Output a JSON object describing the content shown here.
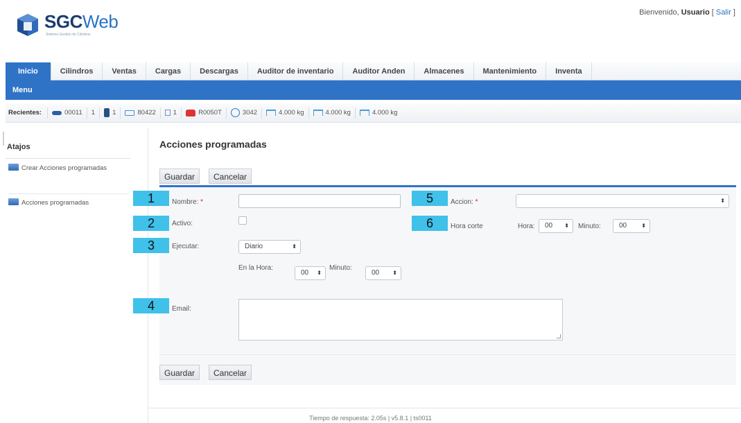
{
  "header": {
    "logo_bold": "SGC",
    "logo_light": "Web",
    "logo_subtitle": "Sistema Gestión de Cilindros",
    "welcome_prefix": "Bienvenido, ",
    "user_name": "Usuario",
    "logout_open": " [ ",
    "logout_label": "Salir",
    "logout_close": " ]"
  },
  "nav": {
    "tabs": [
      "Inicio",
      "Cilindros",
      "Ventas",
      "Cargas",
      "Descargas",
      "Auditor de inventario",
      "Auditor Anden",
      "Almacenes",
      "Mantenimiento",
      "Inventa"
    ],
    "menu_label": "Menu"
  },
  "recents": {
    "label": "Recientes:",
    "items": [
      "00011",
      "1",
      "1",
      "80422",
      "1",
      "R0050T",
      "3042",
      "4.000 kg",
      "4.000 kg",
      "4.000 kg"
    ]
  },
  "sidebar": {
    "heading": "Atajos",
    "items": [
      "Crear Acciones programadas",
      "Acciones programadas"
    ]
  },
  "page": {
    "title": "Acciones programadas",
    "save_label": "Guardar",
    "cancel_label": "Cancelar"
  },
  "form": {
    "nombre_label": "Nombre:",
    "required_mark": " *",
    "activo_label": "Activo:",
    "ejecutar_label": "Ejecutar:",
    "ejecutar_value": "Diario",
    "en_la_hora_label": "En la Hora:",
    "hora_value": "00",
    "minuto_label": "Minuto:",
    "minuto_value": "00",
    "email_label": "Email:",
    "accion_label": "Accion:",
    "hora_corte_label": "Hora corte",
    "hc_hora_label": "Hora:",
    "hc_hora_value": "00",
    "hc_minuto_label": "Minuto:",
    "hc_minuto_value": "00"
  },
  "badges": [
    "1",
    "2",
    "3",
    "4",
    "5",
    "6"
  ],
  "footer": {
    "text": "Tiempo de respuesta: 2.05s | v5.8.1 | ts0011"
  },
  "colors": {
    "primary": "#2f73c7",
    "badge": "#3fc1ea"
  }
}
